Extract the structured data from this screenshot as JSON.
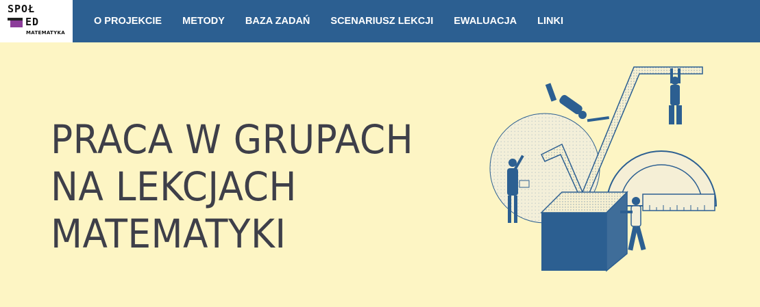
{
  "logo": {
    "line1": "SPOŁ",
    "line2": "ED",
    "subtitle": "MATEMATYKA"
  },
  "nav": {
    "items": [
      {
        "label": "O PROJEKCIE"
      },
      {
        "label": "METODY"
      },
      {
        "label": "BAZA ZADAŃ"
      },
      {
        "label": "SCENARIUSZ LEKCJI"
      },
      {
        "label": "EWALUACJA"
      },
      {
        "label": "LINKI"
      }
    ]
  },
  "hero": {
    "title_lines": [
      "PRACA W GRUPACH",
      "NA LEKCJACH",
      "MATEMATYKI"
    ],
    "illustration_icon": "math-tools-people-illustration"
  },
  "colors": {
    "nav_bg": "#2c5f91",
    "page_bg": "#fdf5c4",
    "title_text": "#3e3f49",
    "logo_accent": "#8c3d9a",
    "illustration_blue": "#2c5f91"
  }
}
